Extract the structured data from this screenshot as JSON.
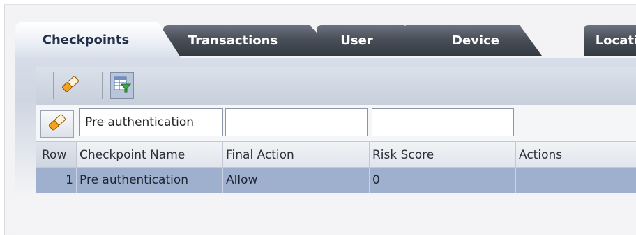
{
  "tabs": [
    {
      "label": "Checkpoints",
      "active": true
    },
    {
      "label": "Transactions",
      "active": false
    },
    {
      "label": "User",
      "active": false
    },
    {
      "label": "Device",
      "active": false
    },
    {
      "label": "Location",
      "active": false
    }
  ],
  "toolbar": {
    "clear_filters_icon": "eraser-icon",
    "filter_icon": "filter-table-icon"
  },
  "filter": {
    "clear_icon": "eraser-icon",
    "checkpoint_name_value": "Pre authentication",
    "final_action_value": "",
    "risk_score_value": ""
  },
  "table": {
    "columns": [
      "Row",
      "Checkpoint Name",
      "Final Action",
      "Risk Score",
      "Actions"
    ],
    "rows": [
      {
        "row": "1",
        "checkpoint_name": "Pre authentication",
        "final_action": "Allow",
        "risk_score": "0",
        "actions": ""
      }
    ]
  },
  "colors": {
    "selected_row": "#9fb0cf",
    "tab_dark": "#3a3f47",
    "tab_active_text": "#20304a"
  }
}
